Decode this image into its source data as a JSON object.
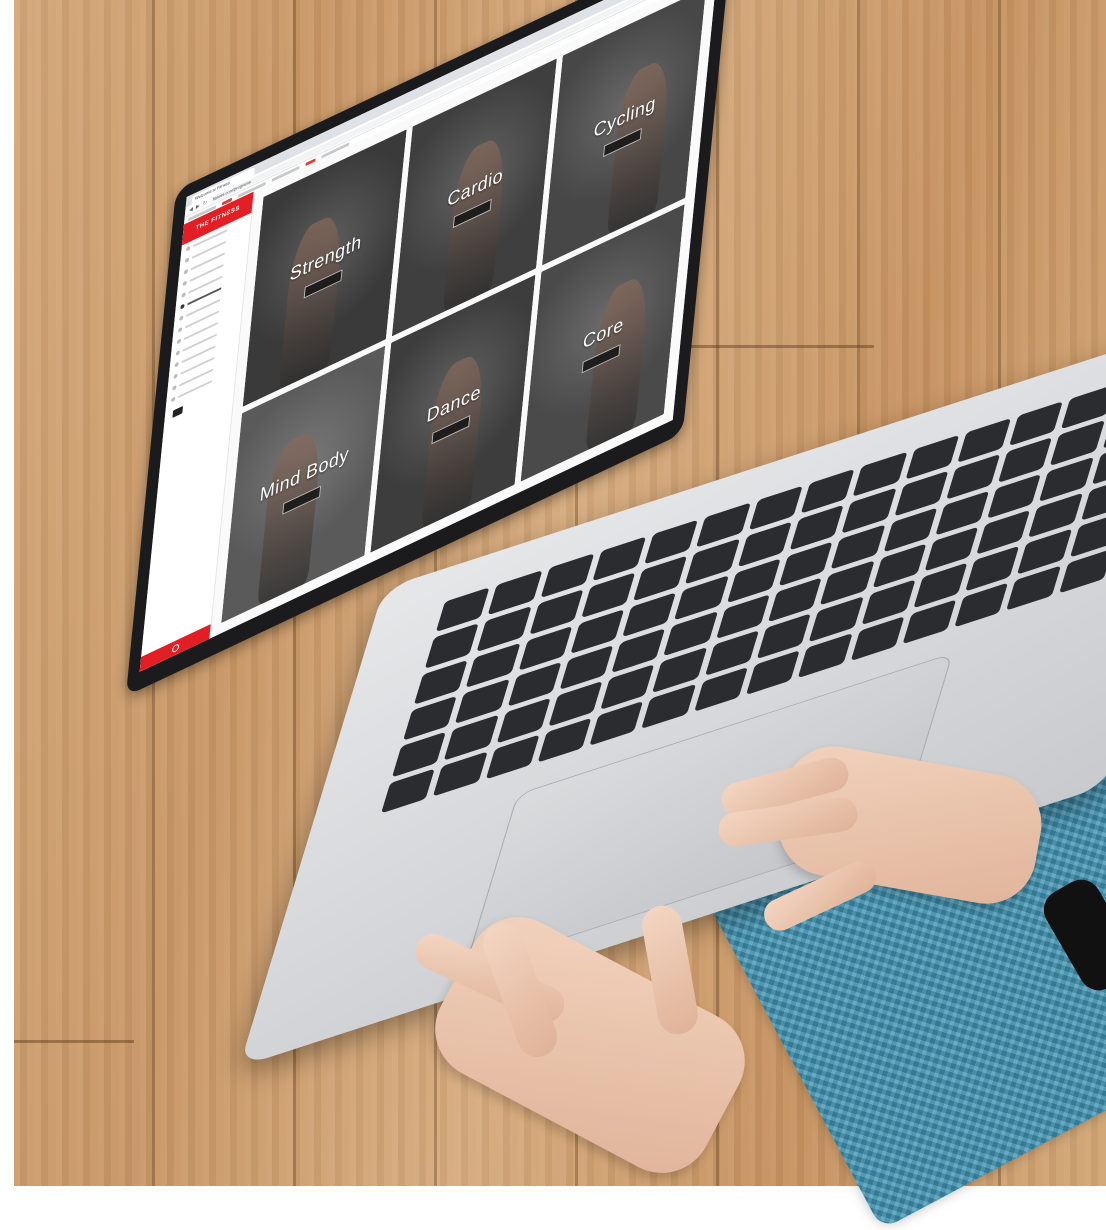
{
  "scene": {
    "description_colors": {
      "floor": "#c99866",
      "mat": "#3f93b3",
      "laptop": "#d3d5d8",
      "keys": "#2b2c2f",
      "brand_red": "#e31e24"
    }
  },
  "browser": {
    "tab_title": "Welcome to Fitness",
    "url": "fitness.com/programs"
  },
  "app": {
    "brand": "THE FITNESS",
    "sidebar_items": [
      "",
      "",
      "",
      "",
      "",
      "",
      "",
      "",
      "",
      "",
      "",
      "",
      "",
      ""
    ],
    "tiles": [
      {
        "title": "Strength",
        "color": "#3a3a3a"
      },
      {
        "title": "Cardio",
        "color": "#3f3f3f"
      },
      {
        "title": "Cycling",
        "color": "#474747"
      },
      {
        "title": "Mind Body",
        "color": "#5a5a5a"
      },
      {
        "title": "Dance",
        "color": "#3d3d3d"
      },
      {
        "title": "Core",
        "color": "#4a4a4a"
      }
    ]
  }
}
